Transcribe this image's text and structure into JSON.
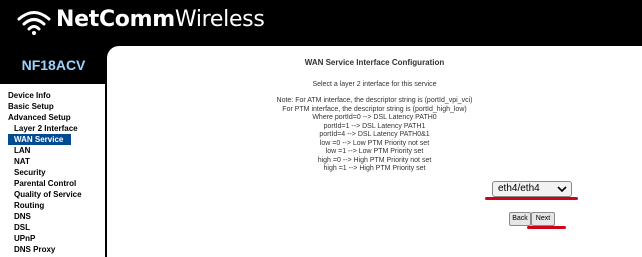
{
  "brand": {
    "bold": "NetComm",
    "light": "Wireless",
    "icon": "wifi-icon"
  },
  "model": "NF18ACV",
  "sidebar": {
    "items": [
      {
        "label": "Device Info",
        "level": 1
      },
      {
        "label": "Basic Setup",
        "level": 1
      },
      {
        "label": "Advanced Setup",
        "level": 1
      },
      {
        "label": "Layer 2 Interface",
        "level": 2
      },
      {
        "label": "WAN Service",
        "level": 2,
        "active": true
      },
      {
        "label": "LAN",
        "level": 2
      },
      {
        "label": "NAT",
        "level": 2
      },
      {
        "label": "Security",
        "level": 2
      },
      {
        "label": "Parental Control",
        "level": 2
      },
      {
        "label": "Quality of Service",
        "level": 2
      },
      {
        "label": "Routing",
        "level": 2
      },
      {
        "label": "DNS",
        "level": 2
      },
      {
        "label": "DSL",
        "level": 2
      },
      {
        "label": "UPnP",
        "level": 2
      },
      {
        "label": "DNS Proxy",
        "level": 2
      }
    ]
  },
  "main": {
    "title": "WAN Service Interface Configuration",
    "subtitle": "Select a layer 2 interface for this service",
    "notes": [
      "Note: For ATM interface, the descriptor string is (portId_vpi_vci)",
      "For PTM interface, the descriptor string is (portId_high_low)",
      "Where portId=0 --> DSL Latency PATH0",
      "portId=1 --> DSL Latency PATH1",
      "portId=4 --> DSL Latency PATH0&1",
      "low =0 --> Low PTM Priority not set",
      "low =1 --> Low PTM Priority set",
      "high =0 --> High PTM Priority not set",
      "high =1 --> High PTM Priority set"
    ],
    "interface_select": {
      "value": "eth4/eth4"
    },
    "back_label": "Back",
    "next_label": "Next"
  },
  "colors": {
    "accent": "#004b91",
    "highlight": "#d0021b",
    "model": "#9ad3ff"
  }
}
